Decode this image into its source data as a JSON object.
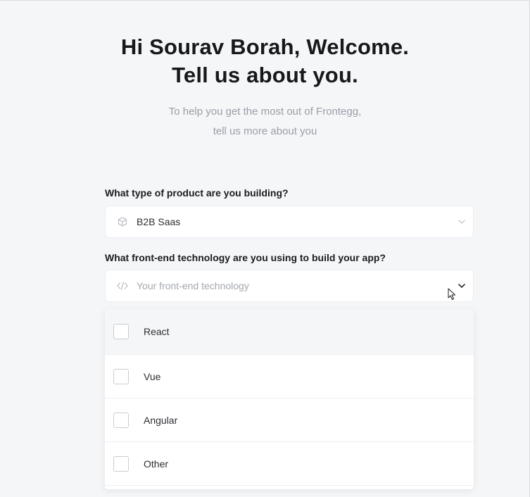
{
  "header": {
    "title_line1": "Hi Sourav Borah, Welcome.",
    "title_line2": "Tell us about you.",
    "subtitle_line1": "To help you get the most out of Frontegg,",
    "subtitle_line2": "tell us more about you"
  },
  "product_question": {
    "label": "What type of product are you building?",
    "selected_value": "B2B Saas",
    "icon": "cube-icon"
  },
  "tech_question": {
    "label": "What front-end technology are you using to build your app?",
    "placeholder": "Your front-end technology",
    "icon": "code-icon",
    "options": [
      {
        "label": "React",
        "checked": false
      },
      {
        "label": "Vue",
        "checked": false
      },
      {
        "label": "Angular",
        "checked": false
      },
      {
        "label": "Other",
        "checked": false
      }
    ]
  }
}
